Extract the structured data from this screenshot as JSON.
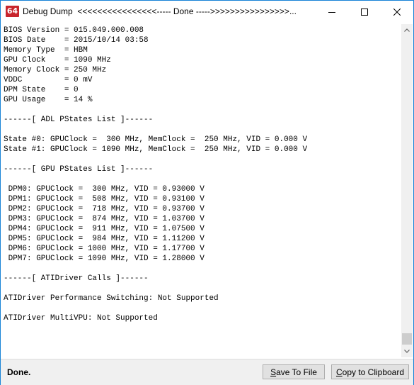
{
  "window": {
    "title": "Debug Dump  <<<<<<<<<<<<<<<<----- Done ----->>>>>>>>>>>>>>>>..."
  },
  "app_icon": {
    "text": "64"
  },
  "controls": {
    "minimize": "minimize-icon",
    "maximize": "maximize-icon",
    "close": "close-icon"
  },
  "dump_lines": [
    "BIOS Version = 015.049.000.008",
    "BIOS Date    = 2015/10/14 03:58",
    "Memory Type  = HBM",
    "GPU Clock    = 1090 MHz",
    "Memory Clock = 250 MHz",
    "VDDC         = 0 mV",
    "DPM State    = 0",
    "GPU Usage    = 14 %",
    "",
    "------[ ADL PStates List ]------",
    "",
    "State #0: GPUClock =  300 MHz, MemClock =  250 MHz, VID = 0.000 V",
    "State #1: GPUClock = 1090 MHz, MemClock =  250 MHz, VID = 0.000 V",
    "",
    "------[ GPU PStates List ]------",
    "",
    " DPM0: GPUClock =  300 MHz, VID = 0.93000 V",
    " DPM1: GPUClock =  508 MHz, VID = 0.93100 V",
    " DPM2: GPUClock =  718 MHz, VID = 0.93700 V",
    " DPM3: GPUClock =  874 MHz, VID = 1.03700 V",
    " DPM4: GPUClock =  911 MHz, VID = 1.07500 V",
    " DPM5: GPUClock =  984 MHz, VID = 1.11200 V",
    " DPM6: GPUClock = 1000 MHz, VID = 1.17700 V",
    " DPM7: GPUClock = 1090 MHz, VID = 1.28000 V",
    "",
    "------[ ATIDriver Calls ]------",
    "",
    "ATIDriver Performance Switching: Not Supported",
    "",
    "ATIDriver MultiVPU: Not Supported"
  ],
  "status": {
    "text": "Done."
  },
  "buttons": {
    "save_label": "Save To File",
    "copy_label": "Copy to Clipboard"
  },
  "colors": {
    "border": "#1883d7",
    "icon_bg": "#c8252c",
    "statusbar_bg": "#f0f0f0"
  }
}
